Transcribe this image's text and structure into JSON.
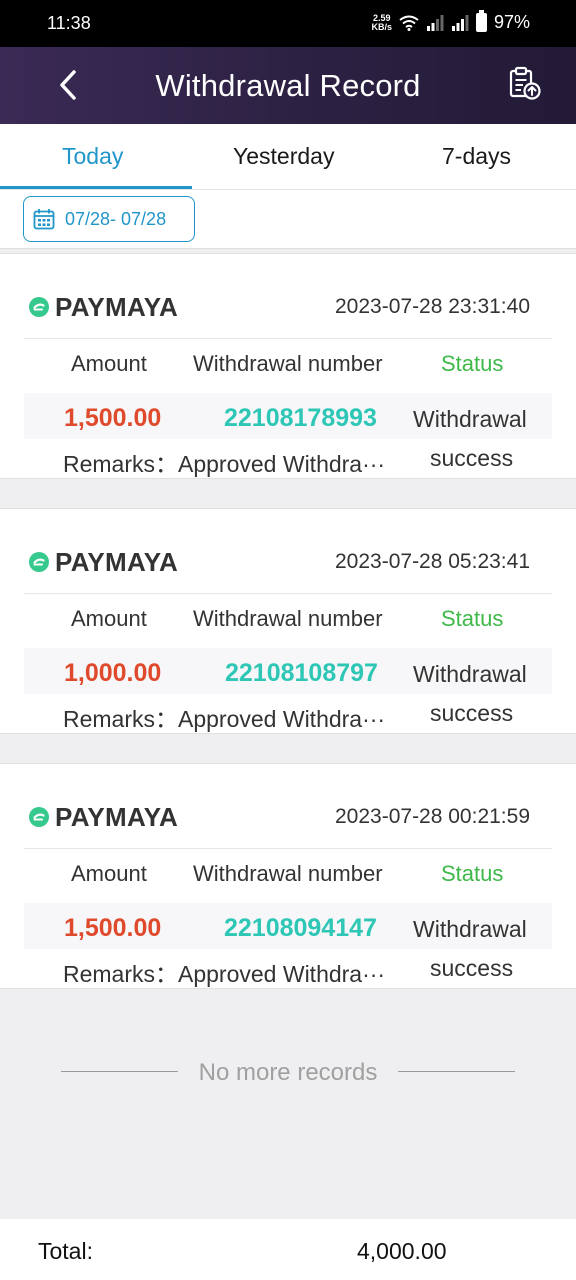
{
  "status_bar": {
    "time": "11:38",
    "net_speed_value": "2.59",
    "net_speed_unit": "KB/s",
    "battery": "97%"
  },
  "header": {
    "title": "Withdrawal Record",
    "back_icon": "chevron-left-icon",
    "export_icon": "clipboard-upload-icon",
    "colors": {
      "start": "#3a2a55",
      "end": "#231a36"
    }
  },
  "tabs": [
    {
      "label": "Today",
      "active": true
    },
    {
      "label": "Yesterday",
      "active": false
    },
    {
      "label": "7-days",
      "active": false
    }
  ],
  "date_filter": {
    "range": "07/28- 07/28",
    "icon": "calendar-icon"
  },
  "columns": {
    "amount": "Amount",
    "number": "Withdrawal number",
    "status": "Status"
  },
  "records": [
    {
      "method": "PAYMAYA",
      "time": "2023-07-28 23:31:40",
      "amount": "1,500.00",
      "number": "22108178993",
      "status_line1": "Withdrawal",
      "status_line2": "success",
      "remarks": "Remarks：Approved Withdra···"
    },
    {
      "method": "PAYMAYA",
      "time": "2023-07-28 05:23:41",
      "amount": "1,000.00",
      "number": "22108108797",
      "status_line1": "Withdrawal",
      "status_line2": "success",
      "remarks": "Remarks：Approved Withdra···"
    },
    {
      "method": "PAYMAYA",
      "time": "2023-07-28 00:21:59",
      "amount": "1,500.00",
      "number": "22108094147",
      "status_line1": "Withdrawal",
      "status_line2": "success",
      "remarks": "Remarks：Approved Withdra···"
    }
  ],
  "no_more": "No more records",
  "footer": {
    "total_label": "Total:",
    "total_value": "4,000.00"
  },
  "colors": {
    "accent": "#2196c9",
    "amount": "#e04a2c",
    "number": "#2ec6b5",
    "status_header": "#3fb84a"
  }
}
